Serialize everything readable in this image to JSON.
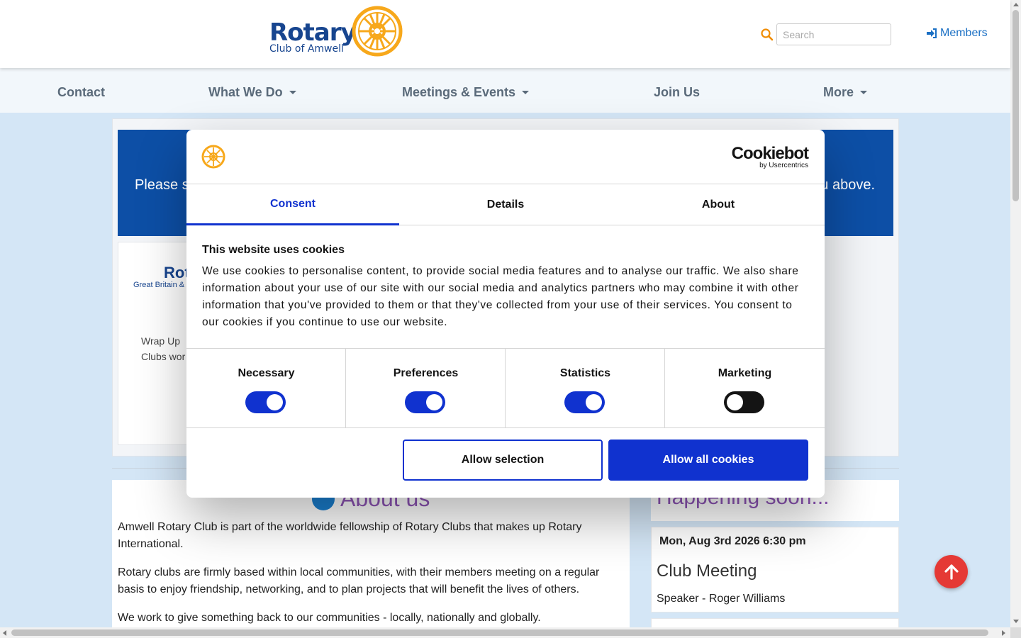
{
  "header": {
    "logo_word": "Rotary",
    "logo_sub": "Club of Amwell",
    "search_placeholder": "Search",
    "members_label": "Members"
  },
  "nav": {
    "items": [
      {
        "label": "Contact"
      },
      {
        "label": "What We Do"
      },
      {
        "label": "Meetings & Events"
      },
      {
        "label": "Join Us"
      },
      {
        "label": "More"
      }
    ]
  },
  "banner": {
    "left_text": "Please s",
    "right_text": "u above."
  },
  "card": {
    "logo": "Rot",
    "logo_sub": "Great Britain & I",
    "line1": "Wrap Up",
    "line2": "Clubs wor"
  },
  "about": {
    "title": "About us",
    "paragraphs": [
      "Amwell Rotary Club is part of the worldwide fellowship of Rotary Clubs that makes up Rotary International.",
      "Rotary clubs are firmly based within local communities, with their members meeting on a regular basis to enjoy friendship, networking, and to plan projects that will benefit the lives of others.",
      "We work to give something back to our communities - locally, nationally and globally."
    ]
  },
  "happening": {
    "title": "Happening soon...",
    "event": {
      "date": "Mon, Aug 3rd 2026 6:30 pm",
      "title": "Club Meeting",
      "speaker": "Speaker - Roger Williams"
    }
  },
  "cookie_dialog": {
    "brand": "Cookiebot",
    "brand_sub": "by Usercentrics",
    "tabs": [
      "Consent",
      "Details",
      "About"
    ],
    "active_tab": "Consent",
    "heading": "This website uses cookies",
    "body": "We use cookies to personalise content, to provide social media features and to analyse our traffic. We also share information about your use of our site with our social media and analytics partners who may combine it with other information that you've provided to them or that they've collected from your use of their services. You consent to our cookies if you continue to use our website.",
    "preferences": [
      {
        "label": "Necessary",
        "on": true
      },
      {
        "label": "Preferences",
        "on": true
      },
      {
        "label": "Statistics",
        "on": true
      },
      {
        "label": "Marketing",
        "on": false
      }
    ],
    "btn_selection": "Allow selection",
    "btn_all": "Allow all cookies"
  },
  "colors": {
    "rotary_blue": "#17458f",
    "rotary_gold": "#f7a81b",
    "cookiebot_blue": "#1032cf",
    "back_to_top": "#e53935",
    "heading_purple": "#8e55b6"
  }
}
